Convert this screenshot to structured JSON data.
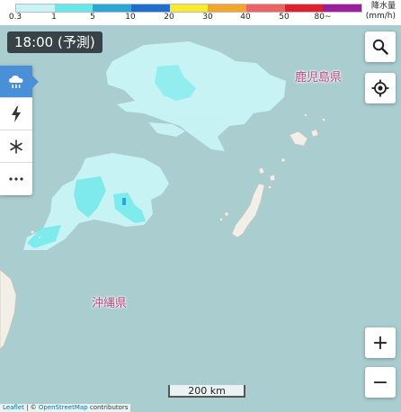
{
  "legend": {
    "title_line1": "降水量",
    "title_line2": "(mm/h)",
    "ticks": [
      "0.3",
      "1",
      "5",
      "10",
      "20",
      "30",
      "40",
      "50",
      "80~"
    ],
    "colors": [
      "#c9f4f6",
      "#66e8ea",
      "#2aa9d9",
      "#1e6fd0",
      "#f8ec2a",
      "#f4a62a",
      "#ee6262",
      "#e0202c",
      "#9d1fa0"
    ]
  },
  "time_badge": "18:00 (予測)",
  "side_buttons": [
    {
      "icon": "rain-cloud-icon",
      "glyph": "☂",
      "active": true
    },
    {
      "icon": "lightning-icon",
      "glyph": "ϟ",
      "active": false
    },
    {
      "icon": "snowflake-icon",
      "glyph": "❄",
      "active": false
    },
    {
      "icon": "more-icon",
      "glyph": "•••",
      "active": false
    }
  ],
  "labels": {
    "kagoshima": "鹿児島県",
    "okinawa": "沖縄県"
  },
  "scale_text": "200 km",
  "attribution": {
    "leaflet": "Leaflet",
    "separator": " | © ",
    "osm": "OpenStreetMap",
    "suffix": " contributors"
  },
  "controls": {
    "zoom_in": "+",
    "zoom_out": "−"
  },
  "colors": {
    "sea": "#aacdcf",
    "land": "#f2efe8",
    "rain_light": "#c9f4f6",
    "rain_medium": "#66e8ea",
    "rain_heavy": "#2aa9d9",
    "accent": "#4a90d9"
  }
}
